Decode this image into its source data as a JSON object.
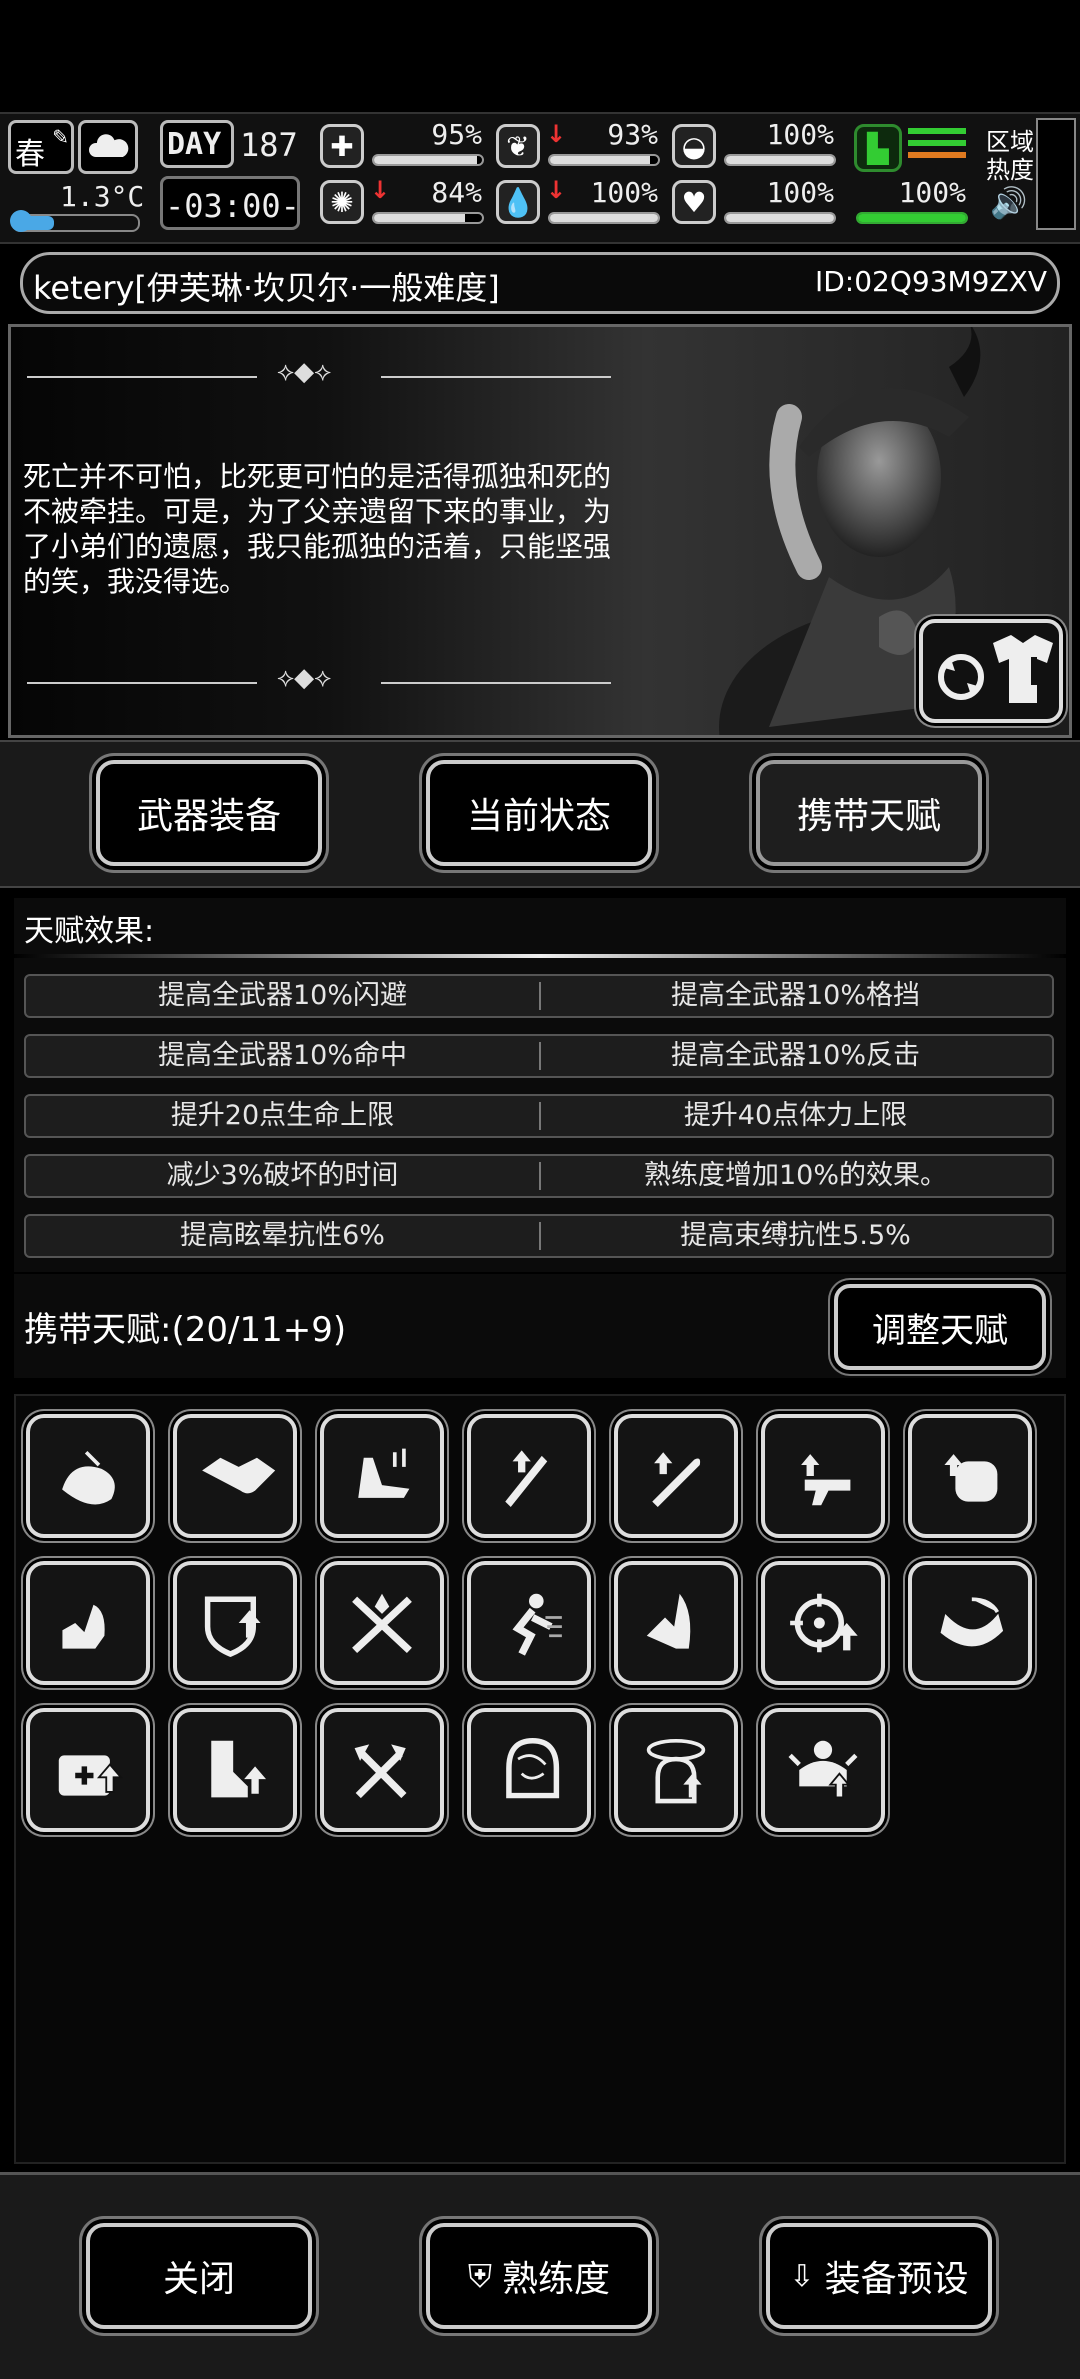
{
  "hud": {
    "season": "春",
    "temperature": "1.3°C",
    "day_label": "DAY",
    "day_number": "187",
    "clock": "-03:00-",
    "stats": [
      {
        "name": "health",
        "icon": "medkit-icon",
        "value": "95%",
        "level": 0.95,
        "falling": false
      },
      {
        "name": "hunger",
        "icon": "stomach-icon",
        "value": "93%",
        "level": 0.93,
        "falling": true
      },
      {
        "name": "hygiene",
        "icon": "capsule-icon",
        "value": "100%",
        "level": 1.0,
        "falling": false
      },
      {
        "name": "infection",
        "icon": "virus-icon",
        "value": "84%",
        "level": 0.84,
        "falling": true
      },
      {
        "name": "thirst",
        "icon": "water-drop-icon",
        "value": "100%",
        "level": 1.0,
        "falling": true
      },
      {
        "name": "mood",
        "icon": "heart-icon",
        "value": "100%",
        "level": 1.0,
        "falling": false
      }
    ],
    "stamina_value": "100%",
    "region_heat_label": "区域\n热度"
  },
  "character": {
    "name": "ketery[伊芙琳·坎贝尔·一般难度]",
    "id": "ID:02Q93M9ZXV",
    "quote": "死亡并不可怕，比死更可怕的是活得孤独和死的不被牵挂。可是，为了父亲遗留下来的事业，为了小弟们的遗愿，我只能孤独的活着，只能坚强的笑，我没得选。"
  },
  "tabs": [
    {
      "label": "武器装备",
      "active": false
    },
    {
      "label": "当前状态",
      "active": false
    },
    {
      "label": "携带天赋",
      "active": true
    }
  ],
  "effects": {
    "title": "天赋效果:",
    "rows": [
      [
        "提高全武器10%闪避",
        "提高全武器10%格挡"
      ],
      [
        "提高全武器10%命中",
        "提高全武器10%反击"
      ],
      [
        "提升20点生命上限",
        "提升40点体力上限"
      ],
      [
        "减少3%破坏的时间",
        "熟练度增加10%的效果。"
      ],
      [
        "提高眩晕抗性6%",
        "提高束缚抗性5.5%"
      ]
    ]
  },
  "carry": {
    "label": "携带天赋:(20/11+9)",
    "adjust_button": "调整天赋"
  },
  "talents": [
    "loot-bag-icon",
    "handshake-icon",
    "speed-boot-icon",
    "machete-up-icon",
    "bat-up-icon",
    "pistol-up-icon",
    "armor-up-icon",
    "strength-arm-icon",
    "shield-up-icon",
    "crossed-swords-burst-icon",
    "dash-icon",
    "dodge-icon",
    "aim-up-icon",
    "grab-arm-icon",
    "medkit-up-icon",
    "boot-up-icon",
    "crossed-axes-icon",
    "brain-head-icon",
    "dizzy-head-icon",
    "break-free-icon"
  ],
  "bottom": {
    "close": "关闭",
    "proficiency": "熟练度",
    "preset": "装备预设"
  }
}
